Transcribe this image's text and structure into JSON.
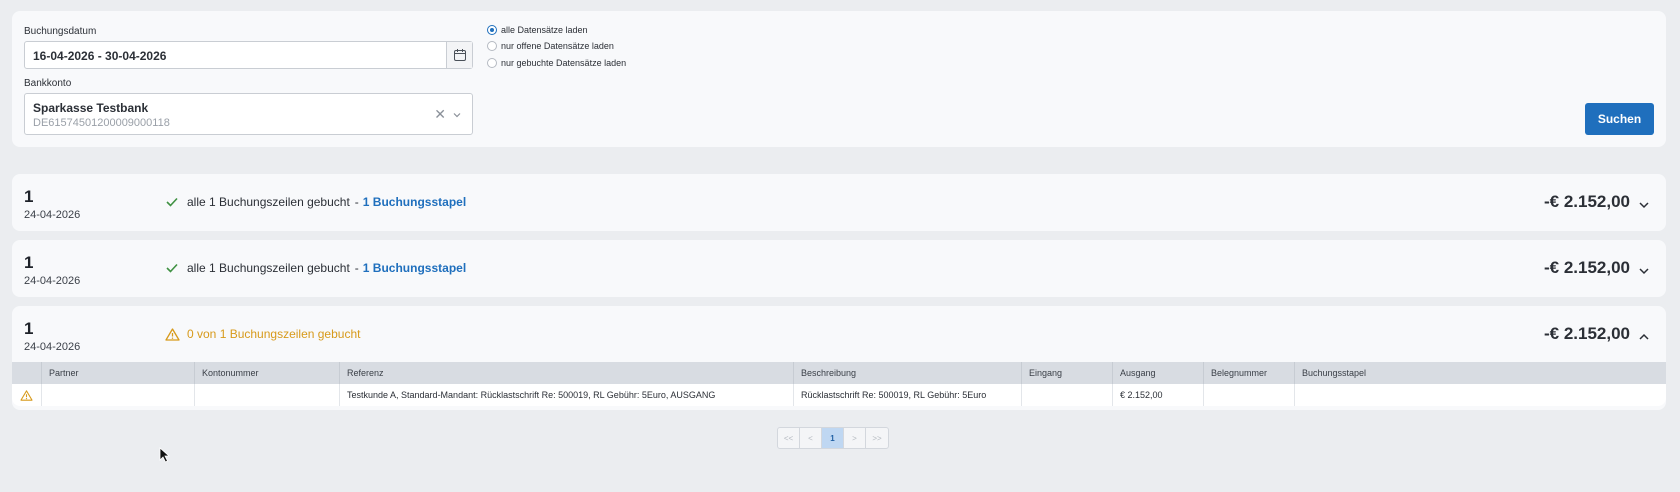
{
  "filter": {
    "date_label": "Buchungsdatum",
    "date_value": "16-04-2026 - 30-04-2026",
    "bank_label": "Bankkonto",
    "bank_name": "Sparkasse Testbank",
    "bank_iban": "DE61574501200009000118",
    "radios": [
      {
        "label": "alle Datensätze laden",
        "checked": true
      },
      {
        "label": "nur offene Datensätze laden",
        "checked": false
      },
      {
        "label": "nur gebuchte Datensätze laden",
        "checked": false
      }
    ],
    "search_label": "Suchen"
  },
  "groups": [
    {
      "num": "1",
      "date": "24-04-2026",
      "status": "alle 1 Buchungszeilen gebucht",
      "sep": "-",
      "stack_link": "1 Buchungsstapel",
      "amount": "-€ 2.152,00",
      "state": "booked",
      "expanded": false
    },
    {
      "num": "1",
      "date": "24-04-2026",
      "status": "alle 1 Buchungszeilen gebucht",
      "sep": "-",
      "stack_link": "1 Buchungsstapel",
      "amount": "-€ 2.152,00",
      "state": "booked",
      "expanded": false
    },
    {
      "num": "1",
      "date": "24-04-2026",
      "status": "0 von 1 Buchungszeilen gebucht",
      "amount": "-€ 2.152,00",
      "state": "warning",
      "expanded": true
    }
  ],
  "table": {
    "headers": [
      "",
      "Partner",
      "Kontonummer",
      "Referenz",
      "Beschreibung",
      "Eingang",
      "Ausgang",
      "Belegnummer",
      "Buchungsstapel"
    ],
    "rows": [
      [
        "",
        "",
        "",
        "Testkunde A, Standard-Mandant: Rücklastschrift Re: 500019, RL Gebühr: 5Euro, AUSGANG",
        "Rücklastschrift Re: 500019, RL Gebühr: 5Euro",
        "",
        "€ 2.152,00",
        "",
        ""
      ]
    ]
  },
  "pagination": {
    "first": "<<",
    "prev": "<",
    "current": "1",
    "next": ">",
    "last": ">>"
  },
  "colors": {
    "accent": "#1f6fbd",
    "success": "#3f9142",
    "warning": "#d79a1b"
  }
}
